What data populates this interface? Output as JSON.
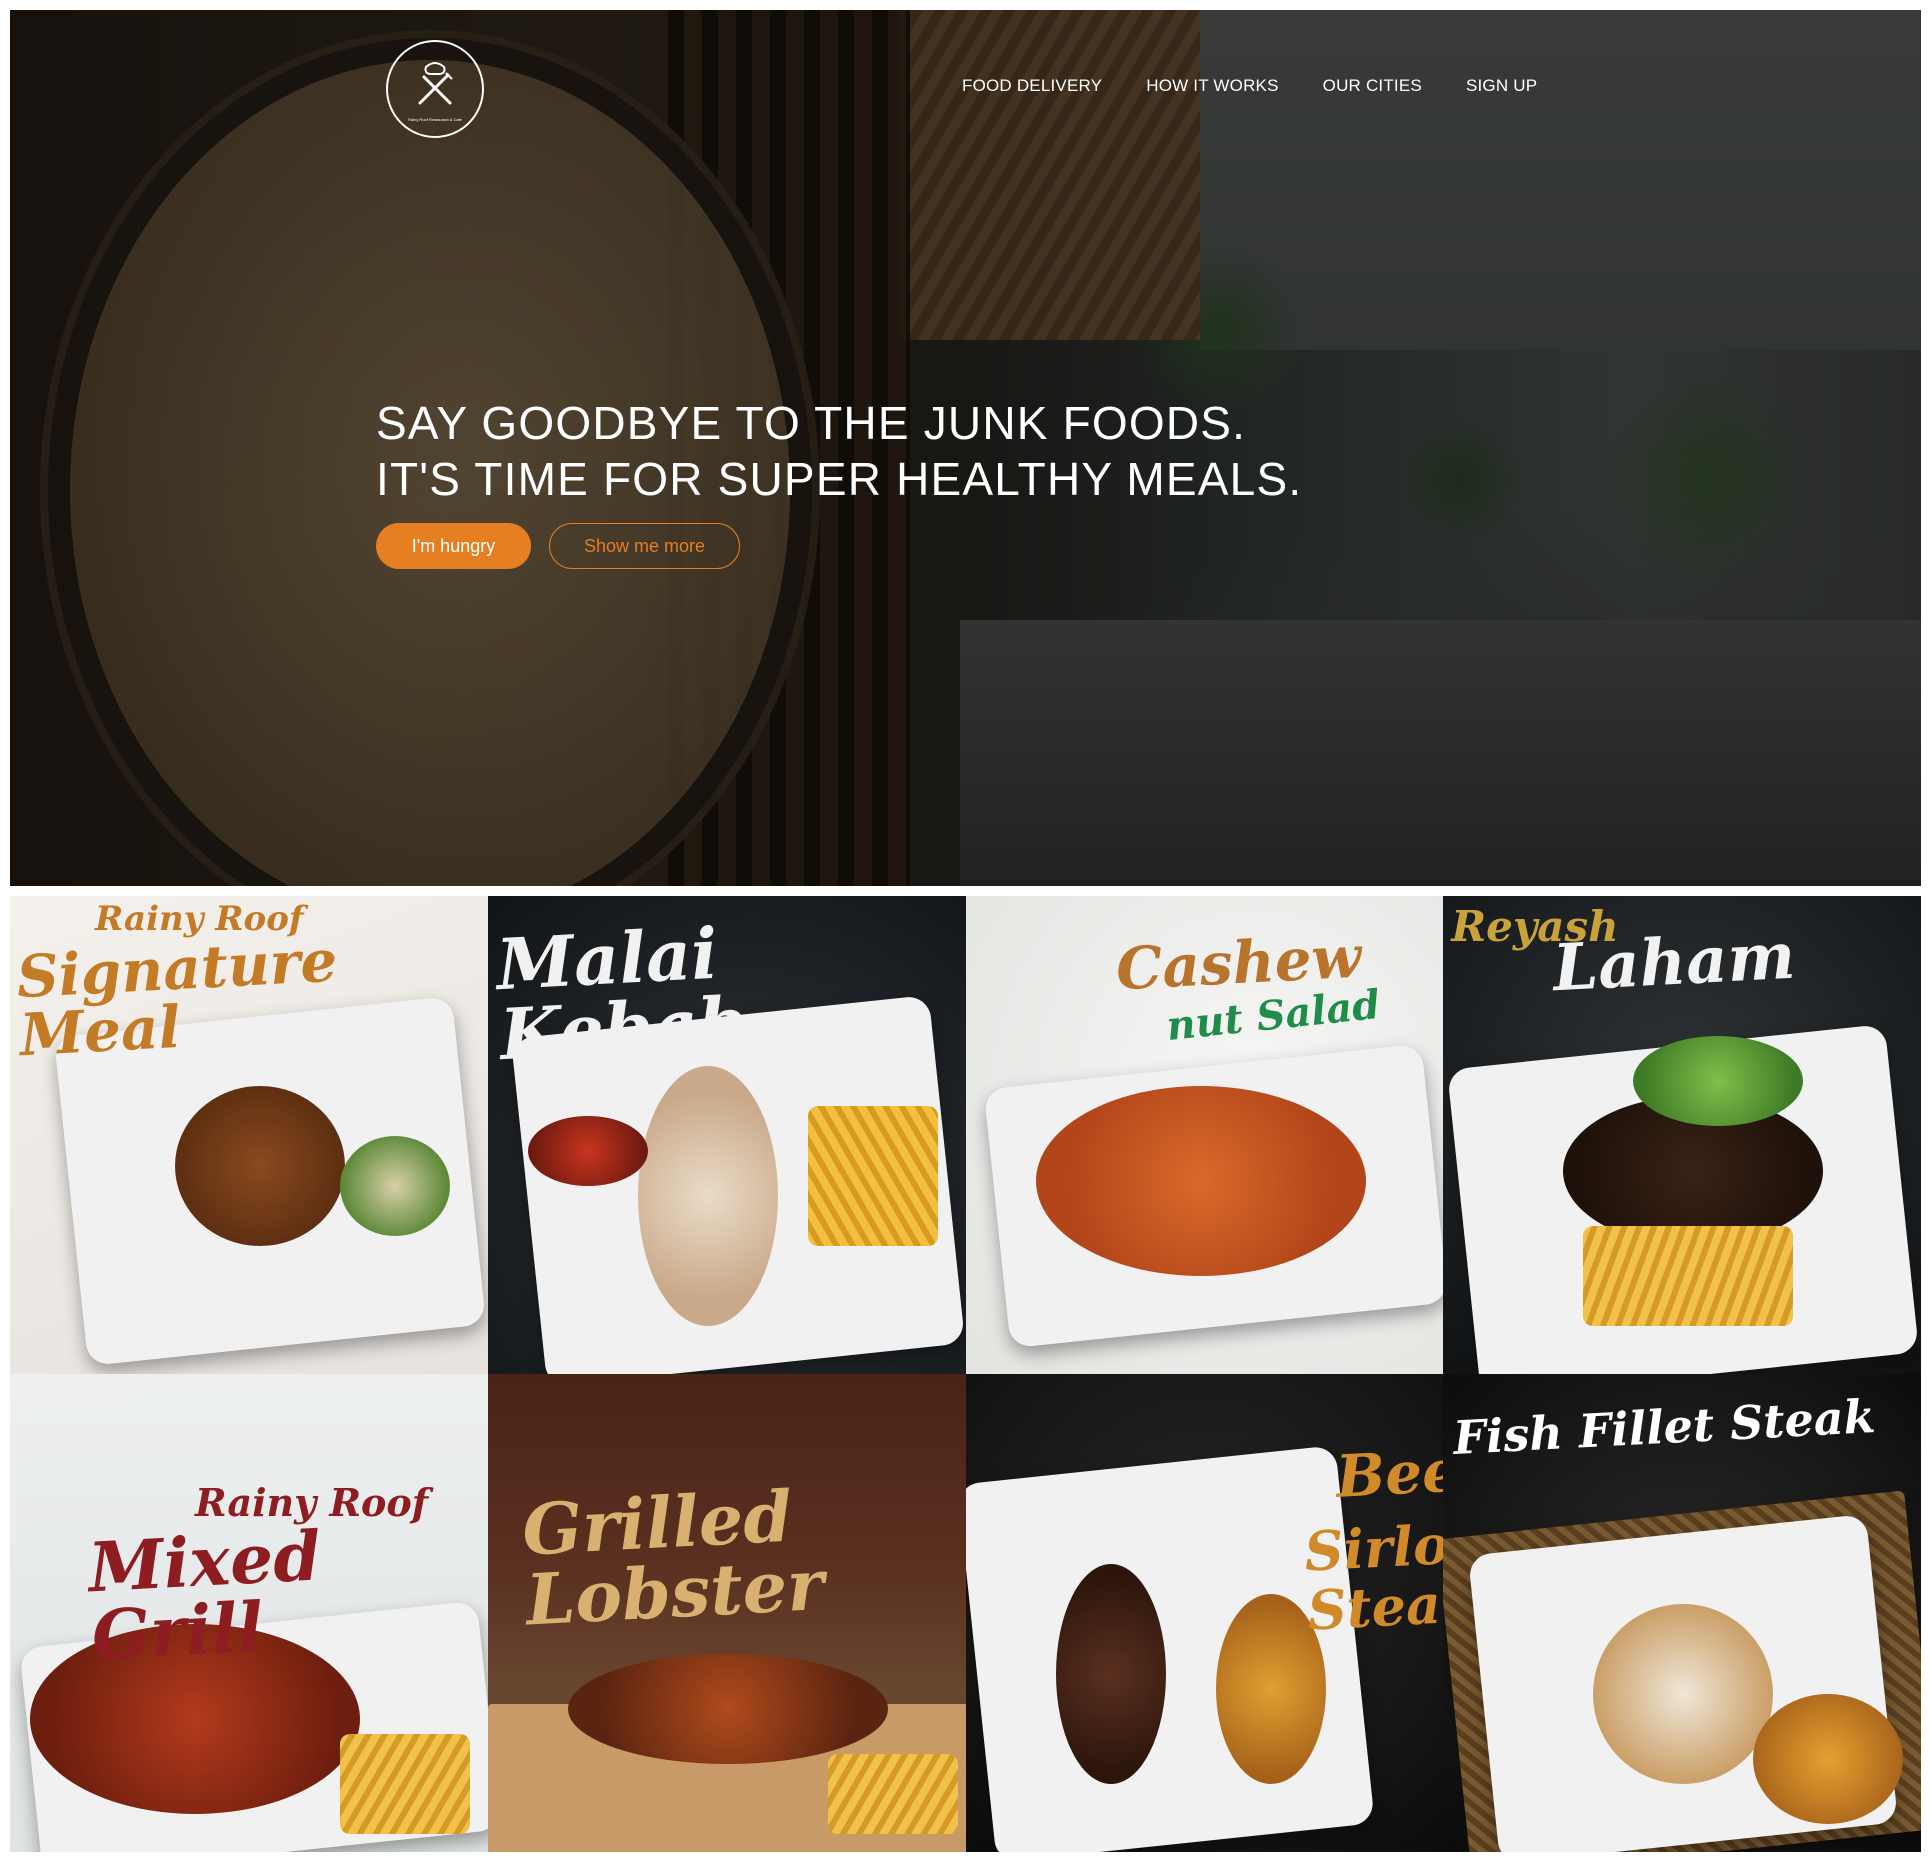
{
  "nav": {
    "items": [
      "FOOD DELIVERY",
      "HOW IT WORKS",
      "OUR CITIES",
      "SIGN UP"
    ]
  },
  "logo": {
    "caption": "Rainy Roof Restaurant & Cafe",
    "sign_text": "Restaurant & Cafe"
  },
  "hero": {
    "headline_line1": "SAY GOODBYE TO THE JUNK FOODS.",
    "headline_line2": "IT'S TIME FOR SUPER HEALTHY MEALS.",
    "btn_primary": "I'm hungry",
    "btn_secondary": "Show me more"
  },
  "meals": [
    {
      "line1": "Rainy Roof",
      "line2": "Signature Meal"
    },
    {
      "line1": "",
      "line2": "Malai Kebab"
    },
    {
      "line1": "Cashew",
      "line2": "nut Salad"
    },
    {
      "line1": "Reyash",
      "line2": "Laham"
    },
    {
      "line1": "Rainy Roof",
      "line2": "Mixed Grill"
    },
    {
      "line1": "",
      "line2": "Grilled Lobster"
    },
    {
      "line1": "Beef",
      "line2": "Sirloin Steak"
    },
    {
      "line1": "",
      "line2": "Fish Fillet Steak"
    }
  ],
  "colors": {
    "accent": "#e67e22",
    "nav_text": "#ffffff"
  }
}
